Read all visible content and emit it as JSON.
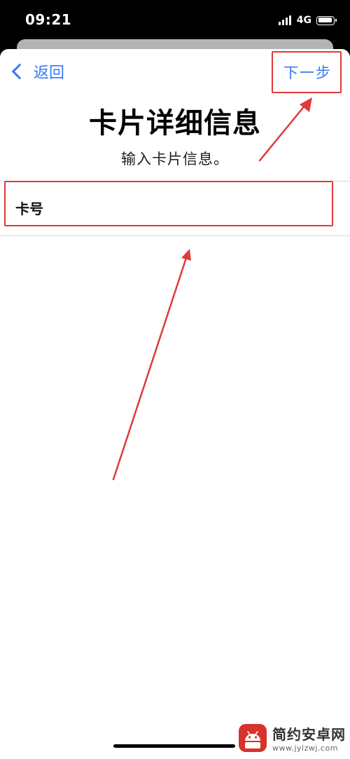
{
  "status_bar": {
    "time": "09:21",
    "network": "4G",
    "signal_icon": "cellular-signal-icon",
    "battery_icon": "battery-icon"
  },
  "nav": {
    "back_label": "返回",
    "back_icon": "chevron-left-icon",
    "next_label": "下一步"
  },
  "header": {
    "title": "卡片详细信息",
    "subtitle": "输入卡片信息。"
  },
  "form": {
    "card_number_placeholder": "卡号"
  },
  "watermark": {
    "name": "简约安卓网",
    "url": "www.jylzwj.com"
  },
  "colors": {
    "accent": "#3478f6",
    "annotation": "#e03a3a"
  }
}
